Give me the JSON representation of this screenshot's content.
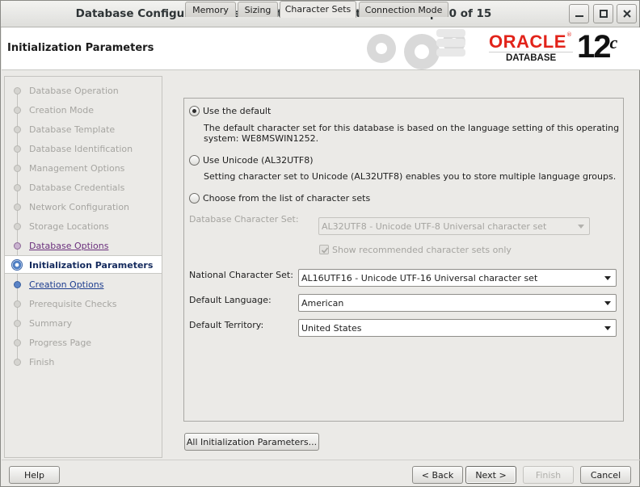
{
  "window": {
    "title": "Database Configuration Assistant - Create Database - Step 10 of 15"
  },
  "header": {
    "page_title": "Initialization Parameters",
    "brand": "ORACLE",
    "brand_sub": "DATABASE",
    "version": "12",
    "version_suffix": "c"
  },
  "nav": {
    "steps": [
      {
        "label": "Database Operation",
        "state": "disabled"
      },
      {
        "label": "Creation Mode",
        "state": "disabled"
      },
      {
        "label": "Database Template",
        "state": "disabled"
      },
      {
        "label": "Database Identification",
        "state": "disabled"
      },
      {
        "label": "Management Options",
        "state": "disabled"
      },
      {
        "label": "Database Credentials",
        "state": "disabled"
      },
      {
        "label": "Network Configuration",
        "state": "disabled"
      },
      {
        "label": "Storage Locations",
        "state": "disabled"
      },
      {
        "label": "Database Options",
        "state": "done"
      },
      {
        "label": "Initialization Parameters",
        "state": "current"
      },
      {
        "label": "Creation Options",
        "state": "next"
      },
      {
        "label": "Prerequisite Checks",
        "state": "disabled"
      },
      {
        "label": "Summary",
        "state": "disabled"
      },
      {
        "label": "Progress Page",
        "state": "disabled"
      },
      {
        "label": "Finish",
        "state": "disabled"
      }
    ]
  },
  "tabs": [
    "Memory",
    "Sizing",
    "Character Sets",
    "Connection Mode"
  ],
  "charset": {
    "opt_default": "Use the default",
    "opt_default_desc1": "The default character set for this database is based on the language setting of this operating",
    "opt_default_desc2": "system: WE8MSWIN1252.",
    "opt_unicode": "Use Unicode (AL32UTF8)",
    "opt_unicode_desc": "Setting character set to Unicode (AL32UTF8) enables you to store multiple language groups.",
    "opt_list": "Choose from the list of character sets",
    "db_charset_label": "Database Character Set:",
    "db_charset_value": "AL32UTF8 - Unicode UTF-8 Universal character set",
    "show_recommended": "Show recommended character sets only",
    "national_label": "National Character Set:",
    "national_value": "AL16UTF16 - Unicode UTF-16 Universal character set",
    "language_label": "Default Language:",
    "language_value": "American",
    "territory_label": "Default Territory:",
    "territory_value": "United States"
  },
  "buttons": {
    "all_params": "All Initialization Parameters...",
    "help": "Help",
    "back": "< Back",
    "next": "Next >",
    "finish": "Finish",
    "cancel": "Cancel"
  }
}
